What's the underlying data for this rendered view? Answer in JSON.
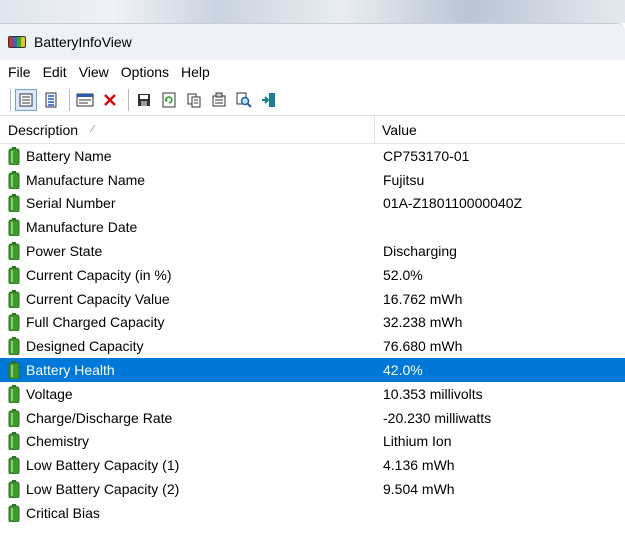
{
  "window": {
    "title": "BatteryInfoView"
  },
  "menu": [
    "File",
    "Edit",
    "View",
    "Options",
    "Help"
  ],
  "toolbar": {
    "buttons": [
      {
        "name": "report-view-icon",
        "pressed": true
      },
      {
        "name": "list-view-icon",
        "pressed": false
      },
      {
        "name": "properties-window-icon",
        "pressed": false
      },
      {
        "name": "delete-icon",
        "pressed": false
      },
      {
        "name": "save-icon",
        "pressed": false
      },
      {
        "name": "refresh-icon",
        "pressed": false
      },
      {
        "name": "copy-icon",
        "pressed": false
      },
      {
        "name": "properties-icon",
        "pressed": false
      },
      {
        "name": "find-icon",
        "pressed": false
      },
      {
        "name": "exit-icon",
        "pressed": false
      }
    ]
  },
  "columns": {
    "description": "Description",
    "value": "Value"
  },
  "rows": [
    {
      "description": "Battery Name",
      "value": "CP753170-01"
    },
    {
      "description": "Manufacture Name",
      "value": "Fujitsu"
    },
    {
      "description": "Serial Number",
      "value": "01A-Z180110000040Z"
    },
    {
      "description": "Manufacture Date",
      "value": ""
    },
    {
      "description": "Power State",
      "value": "Discharging"
    },
    {
      "description": "Current Capacity (in %)",
      "value": "52.0%"
    },
    {
      "description": "Current Capacity Value",
      "value": "16.762 mWh"
    },
    {
      "description": "Full Charged Capacity",
      "value": "32.238 mWh"
    },
    {
      "description": "Designed Capacity",
      "value": "76.680 mWh"
    },
    {
      "description": "Battery Health",
      "value": "42.0%",
      "selected": true
    },
    {
      "description": "Voltage",
      "value": "10.353 millivolts"
    },
    {
      "description": "Charge/Discharge Rate",
      "value": "-20.230 milliwatts"
    },
    {
      "description": "Chemistry",
      "value": "Lithium Ion"
    },
    {
      "description": "Low Battery Capacity (1)",
      "value": "4.136 mWh"
    },
    {
      "description": "Low Battery Capacity (2)",
      "value": "9.504 mWh"
    },
    {
      "description": "Critical Bias",
      "value": ""
    }
  ],
  "colors": {
    "selection": "#0078d7",
    "battery_icon": "#3e9a2e"
  }
}
